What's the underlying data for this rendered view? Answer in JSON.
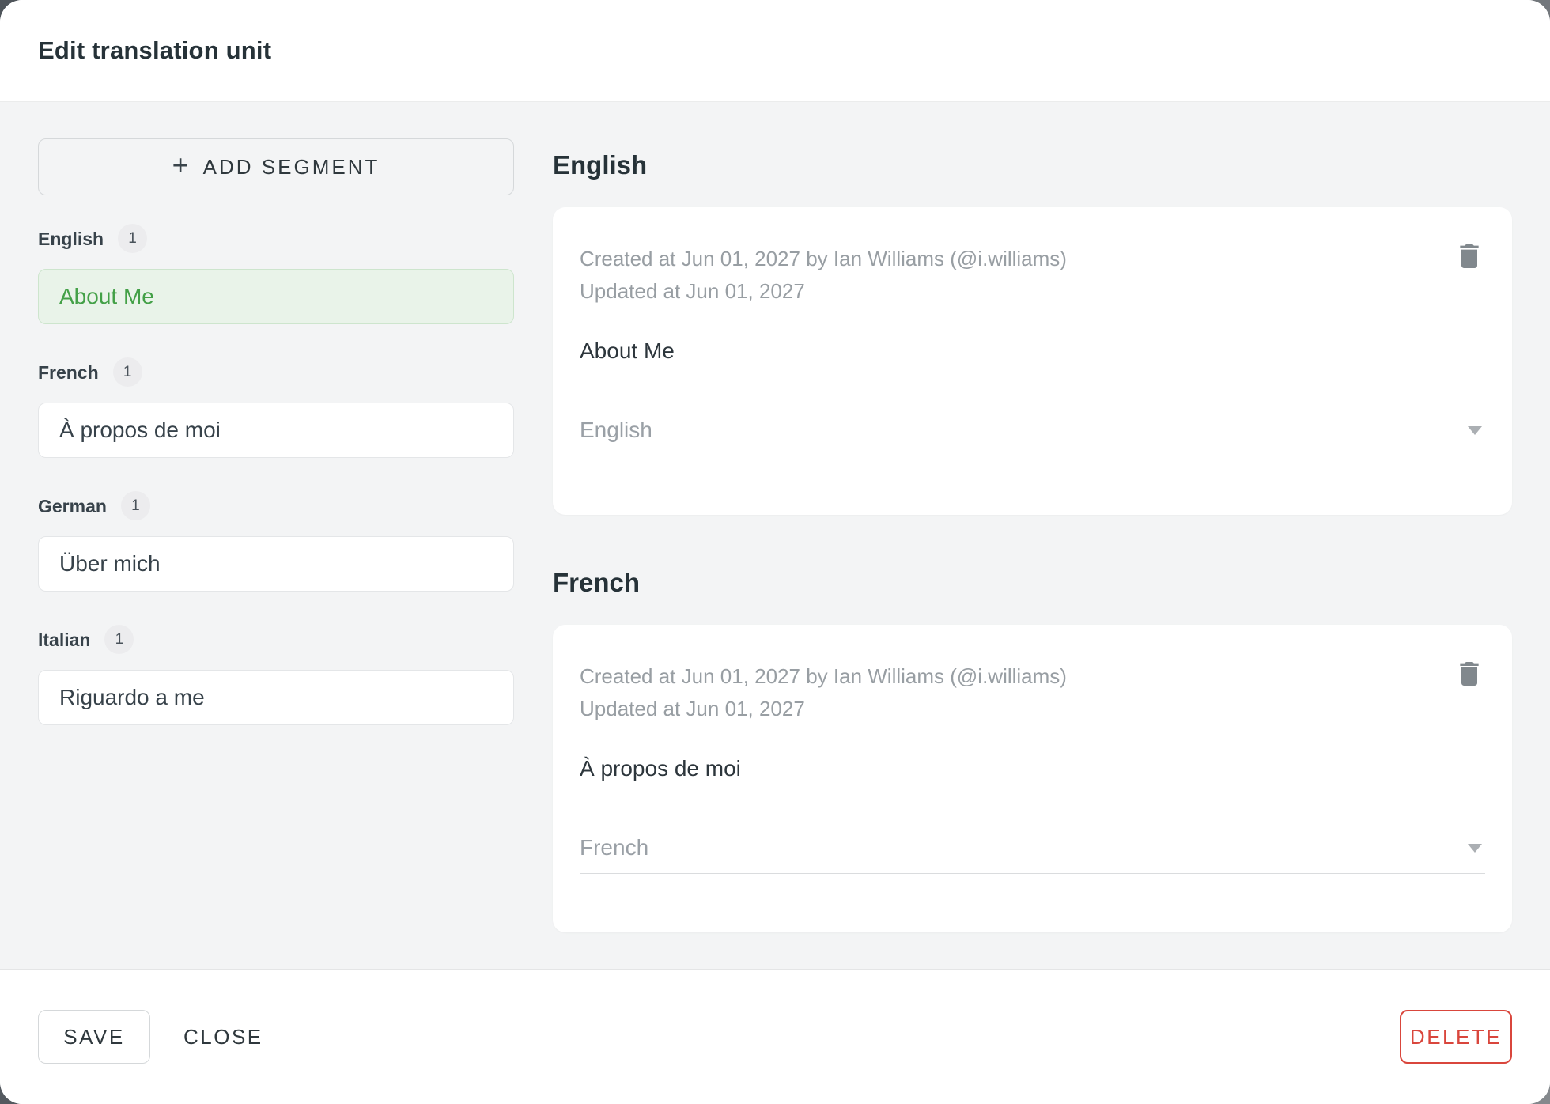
{
  "dialog": {
    "title": "Edit translation unit",
    "add_segment_label": "ADD SEGMENT",
    "add_segment_plus": "+"
  },
  "sidebar": {
    "groups": [
      {
        "language": "English",
        "count": "1",
        "segment": {
          "text": "About Me",
          "selected": true
        }
      },
      {
        "language": "French",
        "count": "1",
        "segment": {
          "text": "À propos de moi",
          "selected": false
        }
      },
      {
        "language": "German",
        "count": "1",
        "segment": {
          "text": "Über mich",
          "selected": false
        }
      },
      {
        "language": "Italian",
        "count": "1",
        "segment": {
          "text": "Riguardo a me",
          "selected": false
        }
      }
    ]
  },
  "editors": [
    {
      "heading": "English",
      "created_line": "Created at Jun 01, 2027 by Ian Williams (@i.williams)",
      "updated_line": "Updated at Jun 01, 2027",
      "content": "About Me",
      "language_select": "English"
    },
    {
      "heading": "French",
      "created_line": "Created at Jun 01, 2027 by Ian Williams (@i.williams)",
      "updated_line": "Updated at Jun 01, 2027",
      "content": "À propos de moi",
      "language_select": "French"
    }
  ],
  "footer": {
    "save_label": "SAVE",
    "close_label": "CLOSE",
    "delete_label": "DELETE"
  },
  "icons": {
    "add": "plus-icon",
    "remove_segment": "trash-icon",
    "language_dropdown": "chevron-down-icon"
  },
  "colors": {
    "accent_green": "#43a047",
    "selected_bg": "#e9f3e9",
    "selected_border": "#cde5cd",
    "danger_red": "#d9463c",
    "meta_text": "#989ea3",
    "backdrop": "#5d6267",
    "body_bg": "#f3f4f5"
  }
}
